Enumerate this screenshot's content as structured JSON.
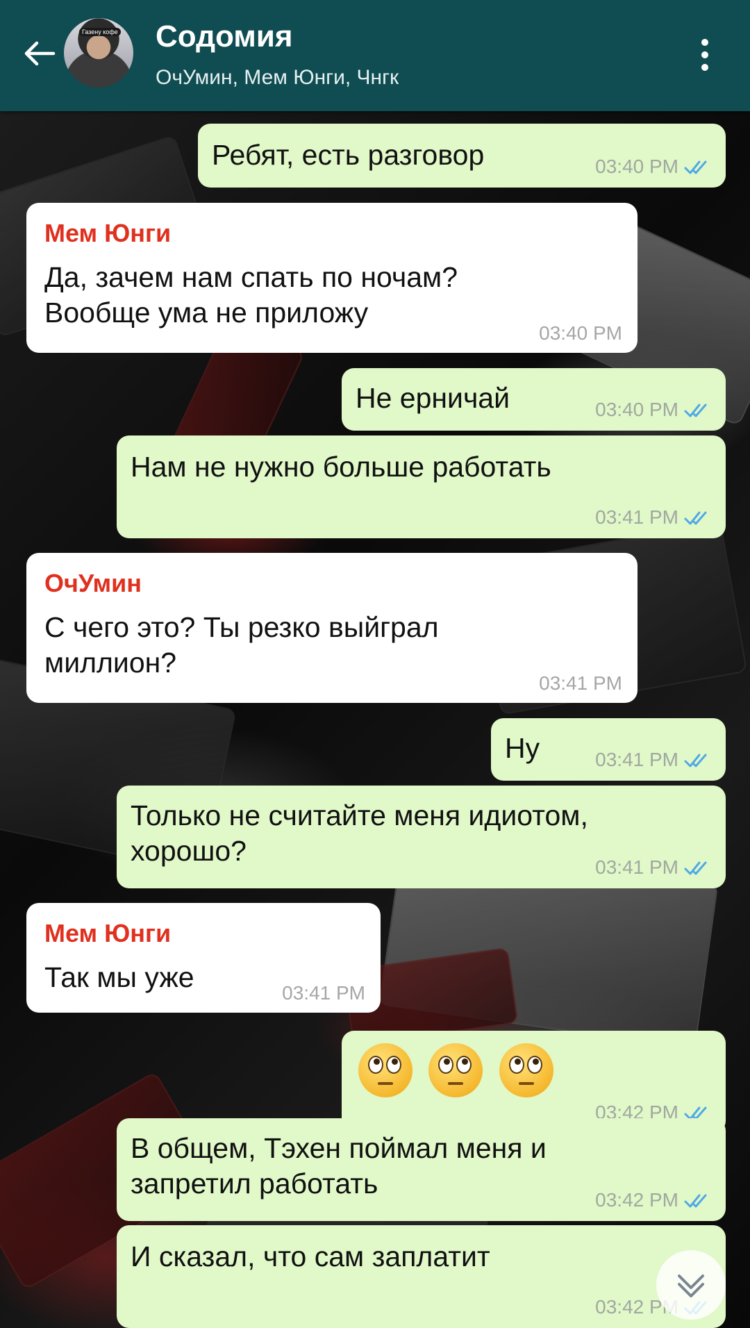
{
  "header": {
    "title": "Содомия",
    "members": "ОчУмин, Мем Юнги, Чнгк",
    "avatar_tag": "Газену кофе",
    "back_icon": "arrow-left-icon",
    "menu_icon": "more-vertical-icon",
    "color": "#0f4d52"
  },
  "colors": {
    "outgoing_bubble": "#e1f8c9",
    "incoming_bubble": "#ffffff",
    "sender_name": "#e0301e",
    "read_check": "#4fa9e6"
  },
  "messages": [
    {
      "dir": "out",
      "text": "Ребят, есть разговор",
      "time": "03:40 PM",
      "read": true
    },
    {
      "dir": "in",
      "sender": "Мем Юнги",
      "text": "Да, зачем нам спать по ночам?\nВообще ума не приложу",
      "time": "03:40 PM"
    },
    {
      "dir": "out",
      "text": "Не ерничай",
      "time": "03:40 PM",
      "read": true
    },
    {
      "dir": "out",
      "text": "Нам не нужно больше работать",
      "time": "03:41 PM",
      "read": true
    },
    {
      "dir": "in",
      "sender": "ОчУмин",
      "text": "С чего это? Ты резко выйграл\nмиллион?",
      "time": "03:41 PM"
    },
    {
      "dir": "out",
      "text": "Ну",
      "time": "03:41 PM",
      "read": true
    },
    {
      "dir": "out",
      "text": "Только не считайте меня идиотом,\nхорошо?",
      "time": "03:41 PM",
      "read": true
    },
    {
      "dir": "in",
      "sender": "Мем Юнги",
      "text": "Так мы уже",
      "time": "03:41 PM"
    },
    {
      "dir": "out",
      "emoji": "face-with-rolling-eyes x3",
      "time": "03:42 PM",
      "read": true
    },
    {
      "dir": "out",
      "text": "В общем, Тэхен поймал меня и\nзапретил работать",
      "time": "03:42 PM",
      "read": true
    },
    {
      "dir": "out",
      "text": "И сказал, что сам заплатит",
      "time": "03:42 PM",
      "read": true
    }
  ],
  "scroll_down_icon": "double-chevron-down-icon"
}
